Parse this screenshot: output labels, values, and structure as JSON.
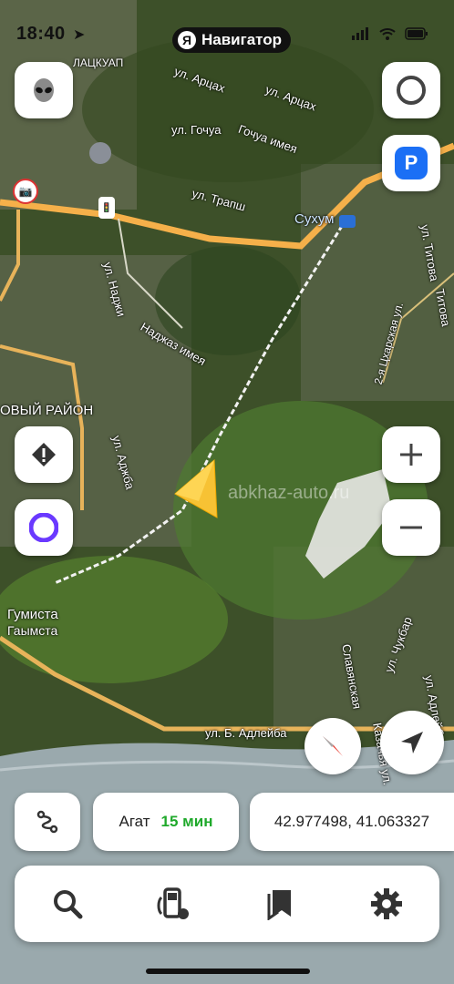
{
  "status_bar": {
    "time": "18:40"
  },
  "app_pill": {
    "logo": "Я",
    "title": "Навигатор"
  },
  "map_labels": {
    "district_top": "ЛАЦКУАП",
    "street_artsakh": "ул. Арцах",
    "street_artsakh_2": "ул. Арцах",
    "street_gochua": "ул. Гочуа",
    "street_gochua_2": "Гочуа имея",
    "street_trapsh": "ул. Трапш",
    "city": "Сухум",
    "street_nadzhi": "ул. Наджи",
    "street_nadzh_2": "Наджаз имея",
    "new_district": "ОВЫЙ РАЙОН",
    "street_adzhba": "ул. Аджба",
    "street_titova": "ул. Титова",
    "street_titov_2": "Титова",
    "street_2_tskhar": "2-я Цхарская ул.",
    "gumista": "Гумиста",
    "gumista_2": "Гаымста",
    "street_chukbar": "ул. Чукбар",
    "street_slav": "Славянская",
    "street_kazach": "Казачья ул.",
    "street_adleiba": "ул. Б. Адлейба",
    "street_adleiba_2": "ул. Адлейба",
    "watermark": "abkhaz-auto.ru"
  },
  "chips": {
    "destination": "Агат",
    "eta": "15 мин",
    "coords": "42.977498, 41.063327"
  },
  "colors": {
    "accent_green": "#1fa92b",
    "parking_blue": "#1b6ff5",
    "alice_purple": "#6a39ff",
    "road_orange": "#f5b04a"
  },
  "icons": [
    "alien-icon",
    "alice-ring-icon",
    "parking-icon",
    "warning-icon",
    "alice-icon",
    "zoom-in-icon",
    "zoom-out-icon",
    "compass-icon",
    "locate-icon",
    "route-icon",
    "search-icon",
    "fuel-icon",
    "bookmarks-icon",
    "settings-icon"
  ]
}
